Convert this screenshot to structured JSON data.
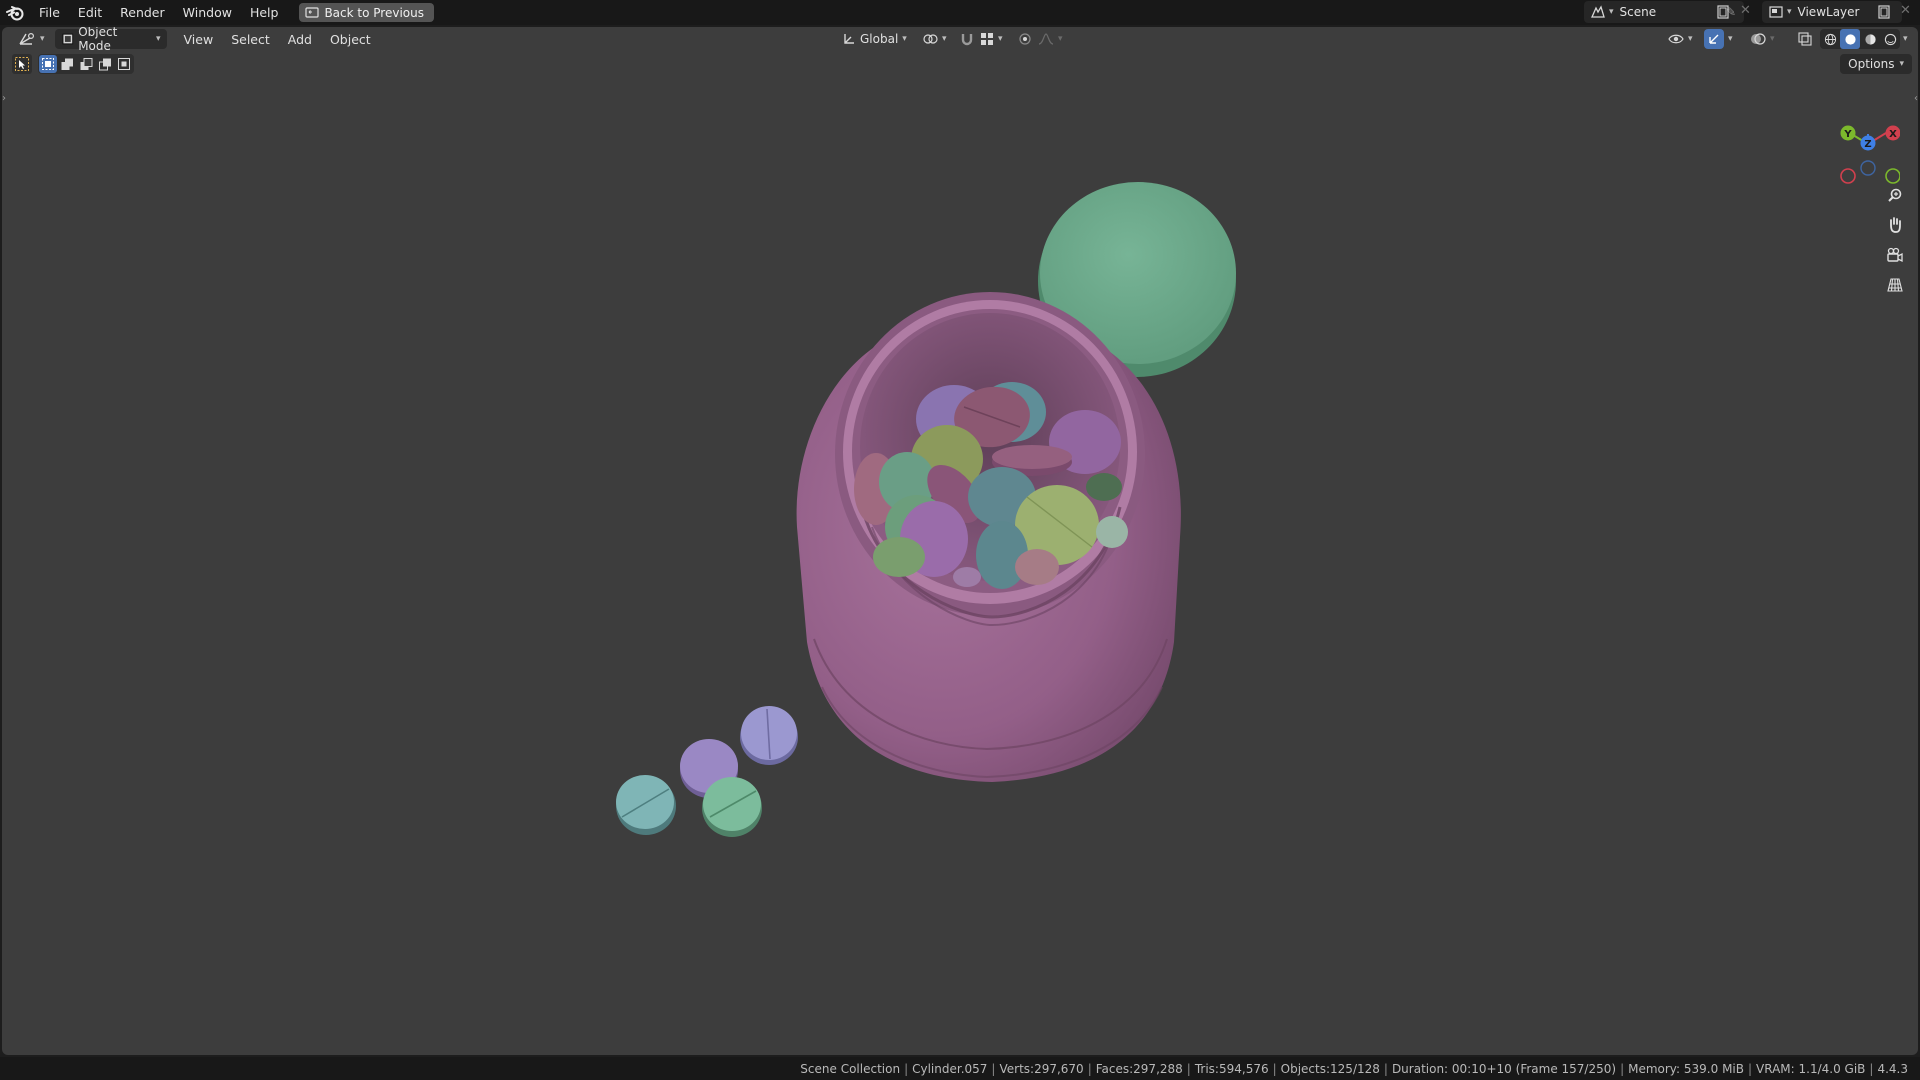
{
  "menu": {
    "items": [
      "File",
      "Edit",
      "Render",
      "Window",
      "Help"
    ],
    "back_button": "Back to Previous"
  },
  "top_right": {
    "scene_name": "Scene",
    "view_layer": "ViewLayer"
  },
  "viewport_header": {
    "mode": "Object Mode",
    "menus": [
      "View",
      "Select",
      "Add",
      "Object"
    ],
    "transform_orientation": "Global",
    "options_label": "Options"
  },
  "gizmo": {
    "x_label": "X",
    "y_label": "Y",
    "z_label": "Z"
  },
  "status_bar": {
    "collection": "Scene Collection",
    "object": "Cylinder.057",
    "verts": "Verts:297,670",
    "faces": "Faces:297,288",
    "tris": "Tris:594,576",
    "objects": "Objects:125/128",
    "duration": "Duration: 00:10+10 (Frame 157/250)",
    "memory": "Memory: 539.0 MiB",
    "vram": "VRAM: 1.1/4.0 GiB",
    "version": "4.4.3"
  },
  "colors": {
    "accent": "#4772b3",
    "viewport_bg": "#3d3d3d",
    "bottle": "#9a6690",
    "lid": "#6da88c",
    "axis_x": "#d2404e",
    "axis_y": "#7cb92c",
    "axis_z": "#3f80e6"
  }
}
